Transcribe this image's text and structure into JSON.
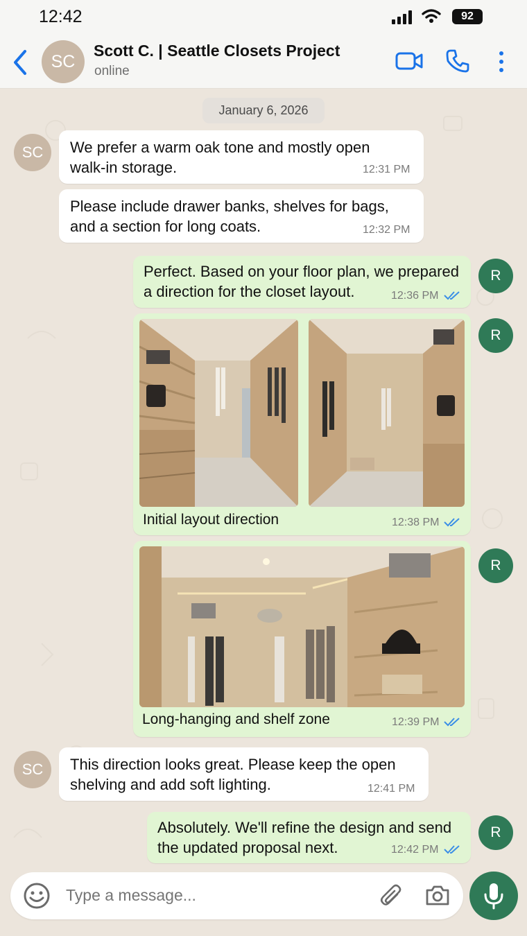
{
  "status_bar": {
    "time": "12:42",
    "battery": "92"
  },
  "header": {
    "avatar_initials": "SC",
    "contact_name": "Scott C. | Seattle  Closets Project",
    "status": "online"
  },
  "date_chip": "January 6, 2026",
  "messages": [
    {
      "direction": "incoming",
      "avatar": "SC",
      "text": "We prefer a warm oak tone and mostly open walk-in storage.",
      "time": "12:31 PM"
    },
    {
      "direction": "incoming",
      "text": "Please include drawer banks, shelves for bags, and a section for long coats.",
      "time": "12:32 PM"
    },
    {
      "direction": "outgoing",
      "avatar": "R",
      "text": "Perfect. Based on your floor plan, we prepared a direction for the closet layout.",
      "time": "12:36 PM"
    },
    {
      "direction": "outgoing",
      "avatar": "R",
      "type": "images",
      "caption": "Initial layout direction",
      "time": "12:38 PM"
    },
    {
      "direction": "outgoing",
      "avatar": "R",
      "type": "image",
      "caption": "Long-hanging and shelf zone",
      "time": "12:39 PM"
    },
    {
      "direction": "incoming",
      "avatar": "SC",
      "text": "This direction looks great. Please keep the open shelving and add soft lighting.",
      "time": "12:41 PM"
    },
    {
      "direction": "outgoing",
      "avatar": "R",
      "text": "Absolutely. We'll refine the design and send the updated proposal next.",
      "time": "12:42 PM"
    }
  ],
  "composer": {
    "placeholder": "Type a message..."
  },
  "colors": {
    "accent": "#1a73e8",
    "sent_bubble": "#e1f5d3",
    "mic_button": "#2f7a57",
    "read_ticks": "#3b8ee6"
  }
}
